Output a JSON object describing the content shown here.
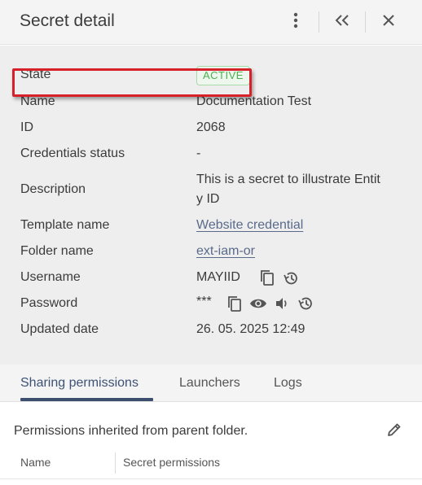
{
  "header": {
    "title": "Secret detail",
    "icons": [
      "more-vert-icon",
      "collapse-double-chevron-icon",
      "close-icon"
    ]
  },
  "details": {
    "state_label": "State",
    "state_value": "ACTIVE",
    "name_label": "Name",
    "name_value": "Documentation Test",
    "id_label": "ID",
    "id_value": "2068",
    "credentials_status_label": "Credentials status",
    "credentials_status_value": "-",
    "description_label": "Description",
    "description_line1": "This is a secret to illustrate Entit",
    "description_line2": "y ID",
    "template_name_label": "Template name",
    "template_name_value": "Website credential",
    "folder_name_label": "Folder name",
    "folder_name_value": "ext-iam-or",
    "username_label": "Username",
    "username_value": "MAYIID",
    "password_label": "Password",
    "password_value": "***",
    "updated_date_label": "Updated date",
    "updated_date_value": "26. 05. 2025 12:49"
  },
  "tabs": [
    {
      "label": "Sharing permissions",
      "active": true
    },
    {
      "label": "Launchers",
      "active": false
    },
    {
      "label": "Logs",
      "active": false
    }
  ],
  "permissions": {
    "inherited_text": "Permissions inherited from parent folder.",
    "columns": [
      "Name",
      "Secret permissions"
    ]
  },
  "colors": {
    "active_badge": "#4caf50",
    "highlight_box": "#d6212a",
    "active_tab": "#3d4f6e",
    "link": "#5a6a8a"
  }
}
